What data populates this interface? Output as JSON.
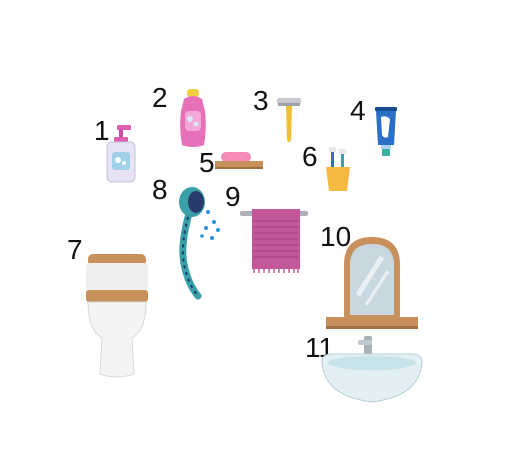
{
  "items": [
    {
      "number": "1",
      "icon": "soap-dispenser-icon"
    },
    {
      "number": "2",
      "icon": "shampoo-bottle-icon"
    },
    {
      "number": "3",
      "icon": "razor-icon"
    },
    {
      "number": "4",
      "icon": "toothpaste-icon"
    },
    {
      "number": "5",
      "icon": "soap-dish-icon"
    },
    {
      "number": "6",
      "icon": "toothbrush-cup-icon"
    },
    {
      "number": "7",
      "icon": "toilet-icon"
    },
    {
      "number": "8",
      "icon": "shower-head-icon"
    },
    {
      "number": "9",
      "icon": "towel-rail-icon"
    },
    {
      "number": "10",
      "icon": "mirror-icon"
    },
    {
      "number": "11",
      "icon": "sink-icon"
    }
  ],
  "colors": {
    "wood": "#c8905a",
    "pink": "#e060b0",
    "teal": "#3aa0a8",
    "blue": "#2a70c8",
    "yellow": "#e8c040"
  }
}
